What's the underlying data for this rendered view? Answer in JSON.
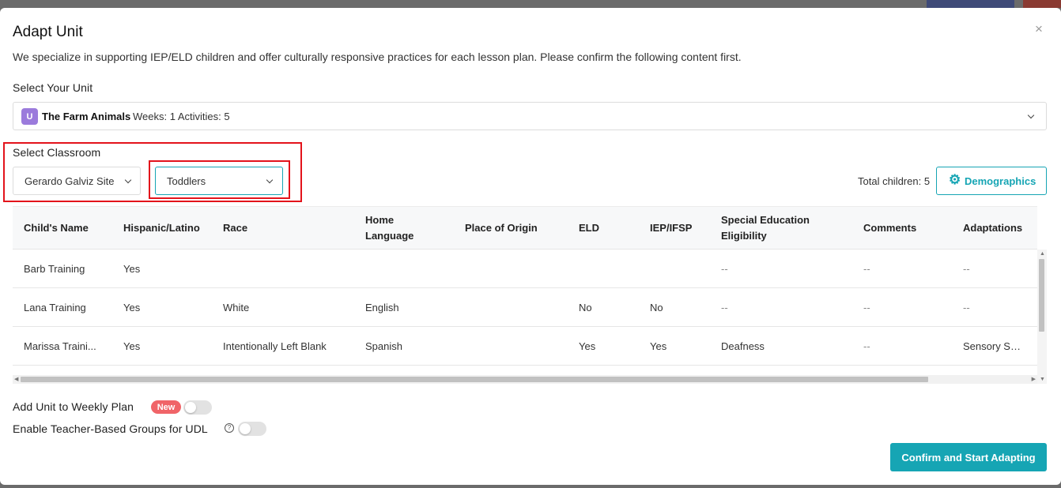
{
  "modal": {
    "title": "Adapt Unit",
    "close_icon": "×",
    "subtitle": "We specialize in supporting IEP/ELD children and offer culturally responsive practices for each lesson plan. Please confirm the following content first."
  },
  "unit": {
    "label": "Select Your Unit",
    "icon_text": "U",
    "name": "The Farm Animals",
    "meta": "Weeks: 1 Activities: 5"
  },
  "classroom": {
    "label": "Select Classroom",
    "site": "Gerardo Galviz Site",
    "class": "Toddlers",
    "total": "Total children: 5",
    "demographics_button": "Demographics"
  },
  "table": {
    "headers": [
      "Child's Name",
      "Hispanic/Latino",
      "Race",
      "Home Language",
      "Place of Origin",
      "ELD",
      "IEP/IFSP",
      "Special Education Eligibility",
      "Comments",
      "Adaptations"
    ],
    "rows": [
      [
        "Barb Training",
        "Yes",
        "",
        "",
        "",
        "",
        "",
        "--",
        "--",
        "--"
      ],
      [
        "Lana Training",
        "Yes",
        "White",
        "English",
        "",
        "No",
        "No",
        "--",
        "--",
        "--"
      ],
      [
        "Marissa Traini...",
        "Yes",
        "Intentionally Left Blank",
        "Spanish",
        "",
        "Yes",
        "Yes",
        "Deafness",
        "--",
        "Sensory Supp..."
      ]
    ]
  },
  "options": {
    "weekly_plan_label": "Add Unit to Weekly Plan",
    "new_badge": "New",
    "udl_label": "Enable Teacher-Based Groups for UDL",
    "help_icon": "?",
    "weekly_plan_enabled": false,
    "udl_enabled": false
  },
  "confirm_button": "Confirm and Start Adapting",
  "colors": {
    "accent": "#16a5b4",
    "badge": "#f06468",
    "highlight": "#e3131b",
    "unit_icon": "#9b7bdc"
  },
  "icons": {
    "close": "close-icon",
    "unit": "unit-icon",
    "gear": "gear-icon",
    "chevron": "chevron-down-icon",
    "help": "help-icon"
  }
}
